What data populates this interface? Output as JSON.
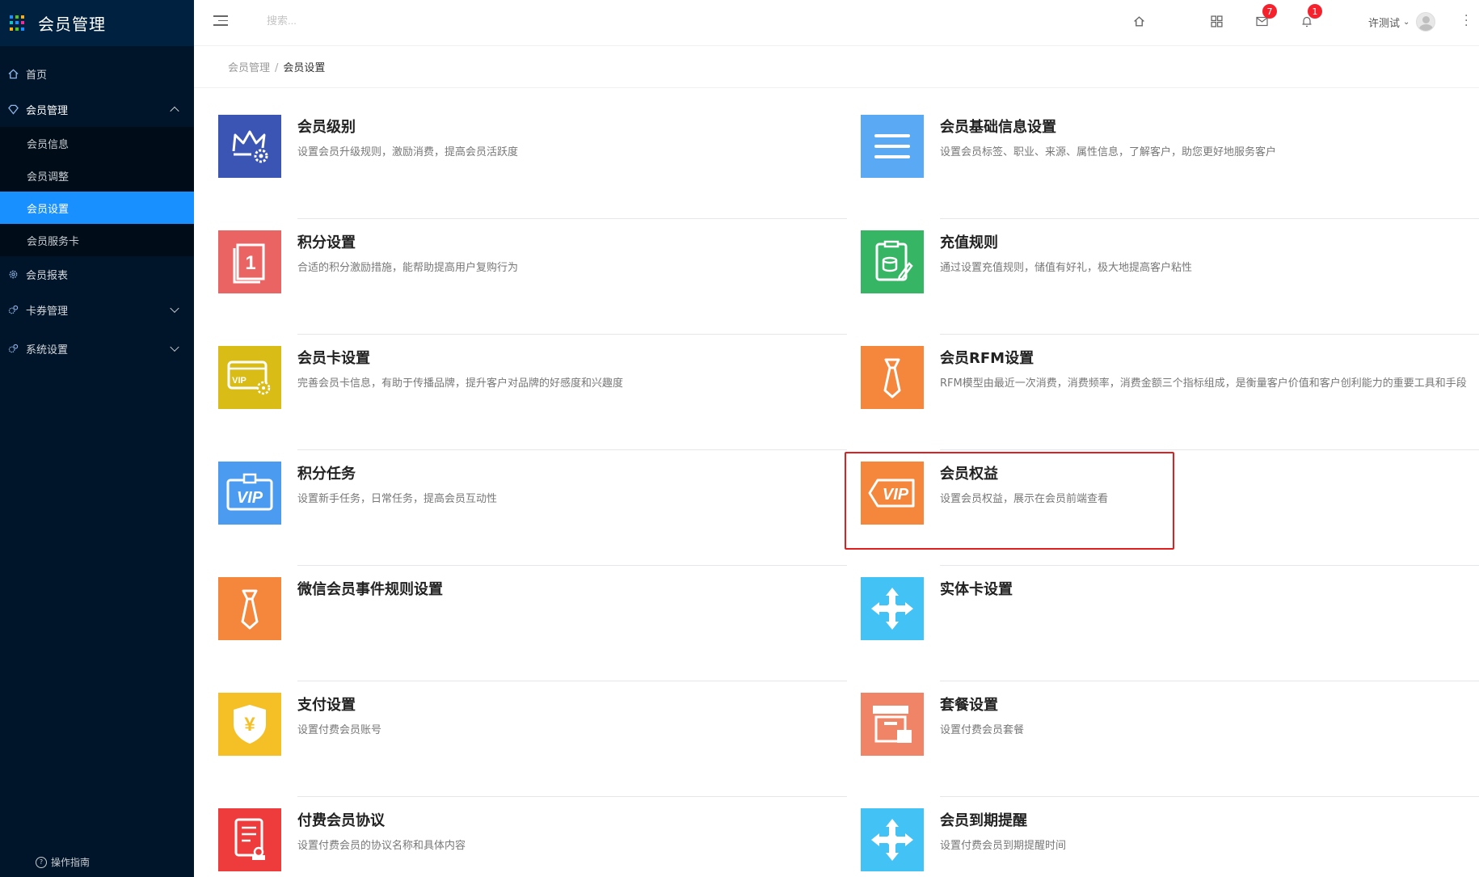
{
  "app": {
    "title": "会员管理"
  },
  "sidebar": {
    "items": [
      {
        "label": "首页"
      },
      {
        "label": "会员管理"
      },
      {
        "label": "会员报表"
      },
      {
        "label": "卡券管理"
      },
      {
        "label": "系统设置"
      }
    ],
    "sub_items": [
      {
        "label": "会员信息"
      },
      {
        "label": "会员调整"
      },
      {
        "label": "会员设置"
      },
      {
        "label": "会员服务卡"
      }
    ],
    "guide": "操作指南"
  },
  "header": {
    "search_placeholder": "搜索...",
    "mail_count": "7",
    "notify_count": "1",
    "user_name": "许测试"
  },
  "breadcrumb": {
    "parent": "会员管理",
    "separator": "/",
    "current": "会员设置"
  },
  "cards": [
    {
      "title": "会员级别",
      "desc": "设置会员升级规则，激励消费，提高会员活跃度",
      "color": "#3b55b5",
      "icon": "crown-gear-icon"
    },
    {
      "title": "会员基础信息设置",
      "desc": "设置会员标签、职业、来源、属性信息，了解客户，助您更好地服务客户",
      "color": "#5aa9f5",
      "icon": "list-icon"
    },
    {
      "title": "积分设置",
      "desc": "合适的积分激励措施，能帮助提高用户复购行为",
      "color": "#ea6464",
      "icon": "points-icon"
    },
    {
      "title": "充值规则",
      "desc": "通过设置充值规则，储值有好礼，极大地提高客户粘性",
      "color": "#36b565",
      "icon": "recharge-icon"
    },
    {
      "title": "会员卡设置",
      "desc": "完善会员卡信息，有助于传播品牌，提升客户对品牌的好感度和兴趣度",
      "color": "#d9bd16",
      "icon": "vip-card-icon"
    },
    {
      "title": "会员RFM设置",
      "desc": "RFM模型由最近一次消费，消费频率，消费金额三个指标组成，是衡量客户价值和客户创利能力的重要工具和手段",
      "color": "#f5873c",
      "icon": "tie-icon"
    },
    {
      "title": "积分任务",
      "desc": "设置新手任务，日常任务，提高会员互动性",
      "color": "#4b9cf0",
      "icon": "vip-badge-icon"
    },
    {
      "title": "会员权益",
      "desc": "设置会员权益，展示在会员前端查看",
      "color": "#f5873c",
      "icon": "vip-tag-icon"
    },
    {
      "title": "微信会员事件规则设置",
      "desc": "",
      "color": "#f5873c",
      "icon": "tie-icon"
    },
    {
      "title": "实体卡设置",
      "desc": "",
      "color": "#42c2f5",
      "icon": "move-icon"
    },
    {
      "title": "支付设置",
      "desc": "设置付费会员账号",
      "color": "#f5c026",
      "icon": "yuan-shield-icon"
    },
    {
      "title": "套餐设置",
      "desc": "设置付费会员套餐",
      "color": "#f08466",
      "icon": "package-icon"
    },
    {
      "title": "付费会员协议",
      "desc": "设置付费会员的协议名称和具体内容",
      "color": "#ee3b3b",
      "icon": "agreement-icon"
    },
    {
      "title": "会员到期提醒",
      "desc": "设置付费会员到期提醒时间",
      "color": "#42c2f5",
      "icon": "move-icon"
    }
  ]
}
